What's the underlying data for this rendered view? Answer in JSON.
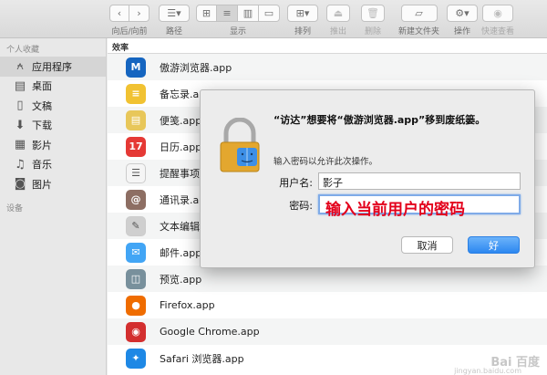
{
  "toolbar": {
    "back_forward": "向后/向前",
    "path": "路径",
    "view": "显示",
    "arrange": "排列",
    "eject": "推出",
    "delete": "删除",
    "new_folder": "新建文件夹",
    "action": "操作",
    "quicklook": "快速查看"
  },
  "sidebar": {
    "favorites_header": "个人收藏",
    "items": [
      {
        "label": "应用程序",
        "icon": "applications-icon",
        "glyph": "⍲"
      },
      {
        "label": "桌面",
        "icon": "desktop-icon",
        "glyph": "▤"
      },
      {
        "label": "文稿",
        "icon": "documents-icon",
        "glyph": "▯"
      },
      {
        "label": "下载",
        "icon": "downloads-icon",
        "glyph": "⬇"
      },
      {
        "label": "影片",
        "icon": "movies-icon",
        "glyph": "▦"
      },
      {
        "label": "音乐",
        "icon": "music-icon",
        "glyph": "♫"
      },
      {
        "label": "图片",
        "icon": "pictures-icon",
        "glyph": "◙"
      }
    ],
    "devices_header": "设备"
  },
  "list": {
    "header": "效率",
    "rows": [
      {
        "name": "傲游浏览器.app",
        "color": "#1565c0",
        "glyph": "M"
      },
      {
        "name": "备忘录.app",
        "color": "#f1c232",
        "glyph": "≡"
      },
      {
        "name": "便笺.app",
        "color": "#e8c75a",
        "glyph": "▤"
      },
      {
        "name": "日历.app",
        "color": "#e53935",
        "glyph": "17"
      },
      {
        "name": "提醒事项.",
        "color": "#f5f5f5",
        "glyph": "☰"
      },
      {
        "name": "通讯录.app",
        "color": "#8d6e63",
        "glyph": "@"
      },
      {
        "name": "文本编辑.",
        "color": "#cfcfcf",
        "glyph": "✎"
      },
      {
        "name": "邮件.app",
        "color": "#42a5f5",
        "glyph": "✉"
      },
      {
        "name": "预览.app",
        "color": "#78909c",
        "glyph": "◫"
      },
      {
        "name": "Firefox.app",
        "color": "#ef6c00",
        "glyph": "●"
      },
      {
        "name": "Google Chrome.app",
        "color": "#d32f2f",
        "glyph": "◉"
      },
      {
        "name": "Safari 浏览器.app",
        "color": "#1e88e5",
        "glyph": "✦"
      }
    ]
  },
  "dialog": {
    "title": "“访达”想要将“傲游浏览器.app”移到废纸篓。",
    "description": "输入密码以允许此次操作。",
    "username_label": "用户名:",
    "username_value": "影子",
    "password_label": "密码:",
    "annotation": "输入当前用户的密码",
    "cancel": "取消",
    "ok": "好"
  },
  "watermark": {
    "text": "Bai 百度",
    "sub": "jingyan.baidu.com"
  }
}
